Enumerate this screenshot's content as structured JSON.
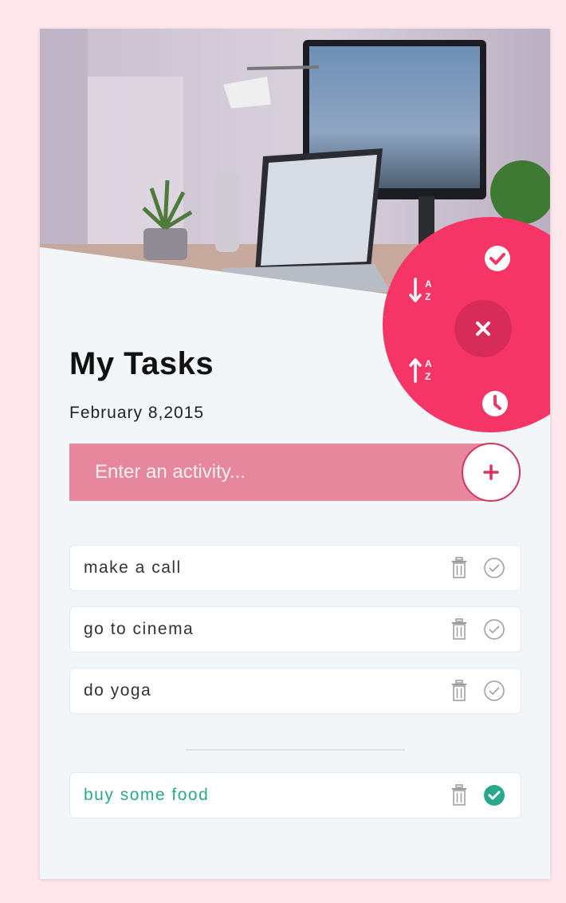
{
  "header": {
    "title": "My Tasks",
    "date": "February 8,2015"
  },
  "entry": {
    "placeholder": "Enter an activity...",
    "add_icon": "plus-icon"
  },
  "fab_menu": {
    "accent_color": "#f53566",
    "actions": [
      "check-icon",
      "sort-ascending-icon",
      "close-icon",
      "sort-descending-icon",
      "clock-icon"
    ]
  },
  "tasks": [
    {
      "label": "make a call",
      "done": false
    },
    {
      "label": "go to cinema",
      "done": false
    },
    {
      "label": "do yoga",
      "done": false
    }
  ],
  "completed": [
    {
      "label": "buy some food",
      "done": true
    }
  ],
  "colors": {
    "entry_bg": "#e7879d",
    "done_text": "#28a98b",
    "page_bg": "#fde7ec"
  }
}
